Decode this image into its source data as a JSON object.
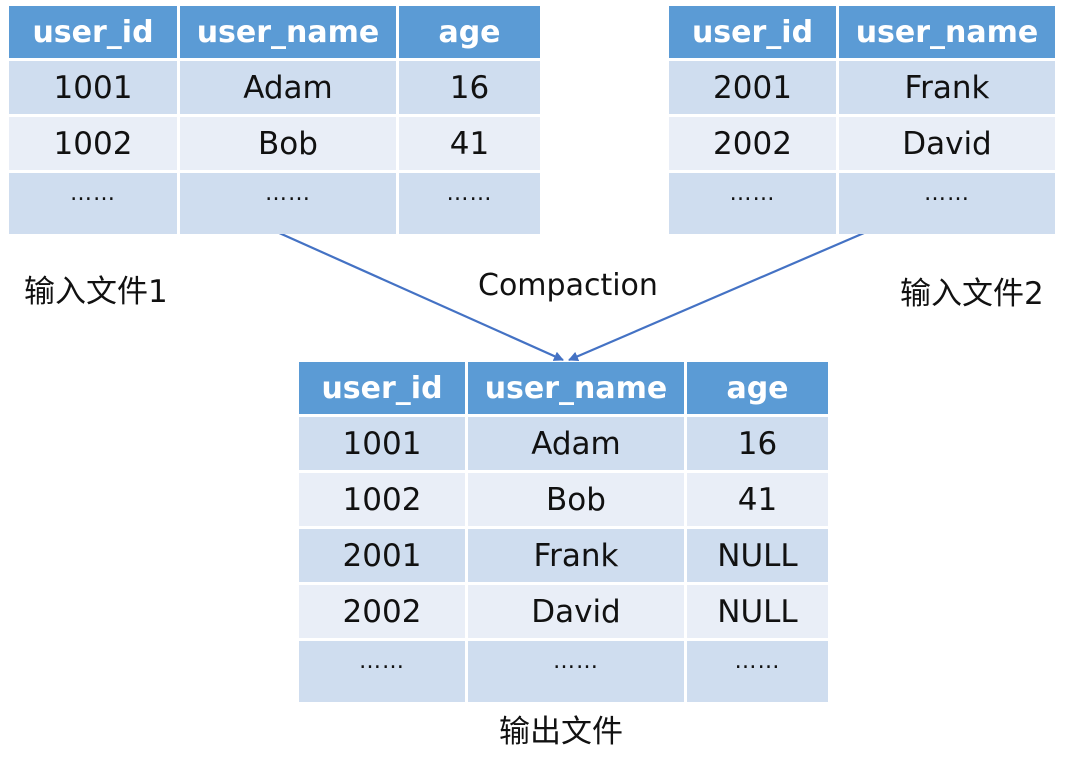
{
  "input_file_1": {
    "label": "输入文件1",
    "columns": [
      "user_id",
      "user_name",
      "age"
    ],
    "rows": [
      [
        "1001",
        "Adam",
        "16"
      ],
      [
        "1002",
        "Bob",
        "41"
      ],
      [
        "……",
        "……",
        "……"
      ]
    ]
  },
  "input_file_2": {
    "label": "输入文件2",
    "columns": [
      "user_id",
      "user_name"
    ],
    "rows": [
      [
        "2001",
        "Frank"
      ],
      [
        "2002",
        "David"
      ],
      [
        "……",
        "……"
      ]
    ]
  },
  "process": {
    "label": "Compaction",
    "arrow_color": "#4472c4"
  },
  "output_file": {
    "label": "输出文件",
    "columns": [
      "user_id",
      "user_name",
      "age"
    ],
    "rows": [
      [
        "1001",
        "Adam",
        "16"
      ],
      [
        "1002",
        "Bob",
        "41"
      ],
      [
        "2001",
        "Frank",
        "NULL"
      ],
      [
        "2002",
        "David",
        "NULL"
      ],
      [
        "……",
        "……",
        "……"
      ]
    ]
  },
  "colors": {
    "header": "#5b9bd5",
    "row_dark": "#cfddef",
    "row_light": "#e9eef7"
  }
}
